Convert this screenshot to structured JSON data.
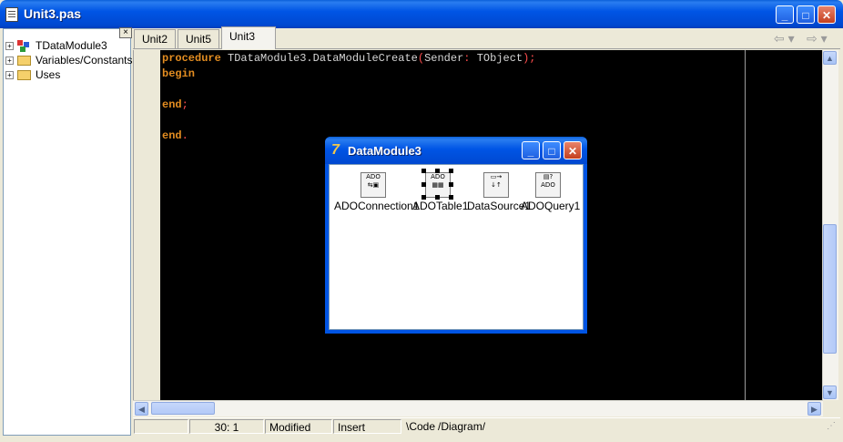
{
  "window": {
    "title": "Unit3.pas"
  },
  "tree": {
    "items": [
      {
        "label": "TDataModule3",
        "icon": "datamodule-icon"
      },
      {
        "label": "Variables/Constants",
        "icon": "folder-icon"
      },
      {
        "label": "Uses",
        "icon": "folder-icon"
      }
    ]
  },
  "tabs": [
    {
      "label": "Unit2"
    },
    {
      "label": "Unit5"
    },
    {
      "label": "Unit3",
      "active": true
    }
  ],
  "code": {
    "line1": {
      "kw": "procedure",
      "name": "TDataModule3.DataModuleCreate",
      "open": "(",
      "param": "Sender",
      "colon": ":",
      "type": "TObject",
      "close": ");"
    },
    "line2": {
      "kw": "begin"
    },
    "line4": {
      "kw": "end",
      "punct": ";"
    },
    "line6": {
      "kw": "end",
      "punct": "."
    }
  },
  "datamodule": {
    "title": "DataModule3",
    "components": [
      {
        "label": "ADOConnection1",
        "icon": "ado-connection-icon"
      },
      {
        "label": "ADOTable1",
        "icon": "ado-table-icon",
        "selected": true
      },
      {
        "label": "DataSource1",
        "icon": "datasource-icon"
      },
      {
        "label": "ADOQuery1",
        "icon": "ado-query-icon"
      }
    ]
  },
  "status": {
    "position": "30:   1",
    "modified": "Modified",
    "mode": "Insert",
    "bottom_tabs": [
      "Code",
      "Diagram"
    ]
  },
  "colors": {
    "titlebar": "#0055e5",
    "editor_bg": "#000000",
    "keyword": "#e38d21",
    "identifier": "#d6d6d6",
    "punctuation": "#ff4d4d"
  }
}
